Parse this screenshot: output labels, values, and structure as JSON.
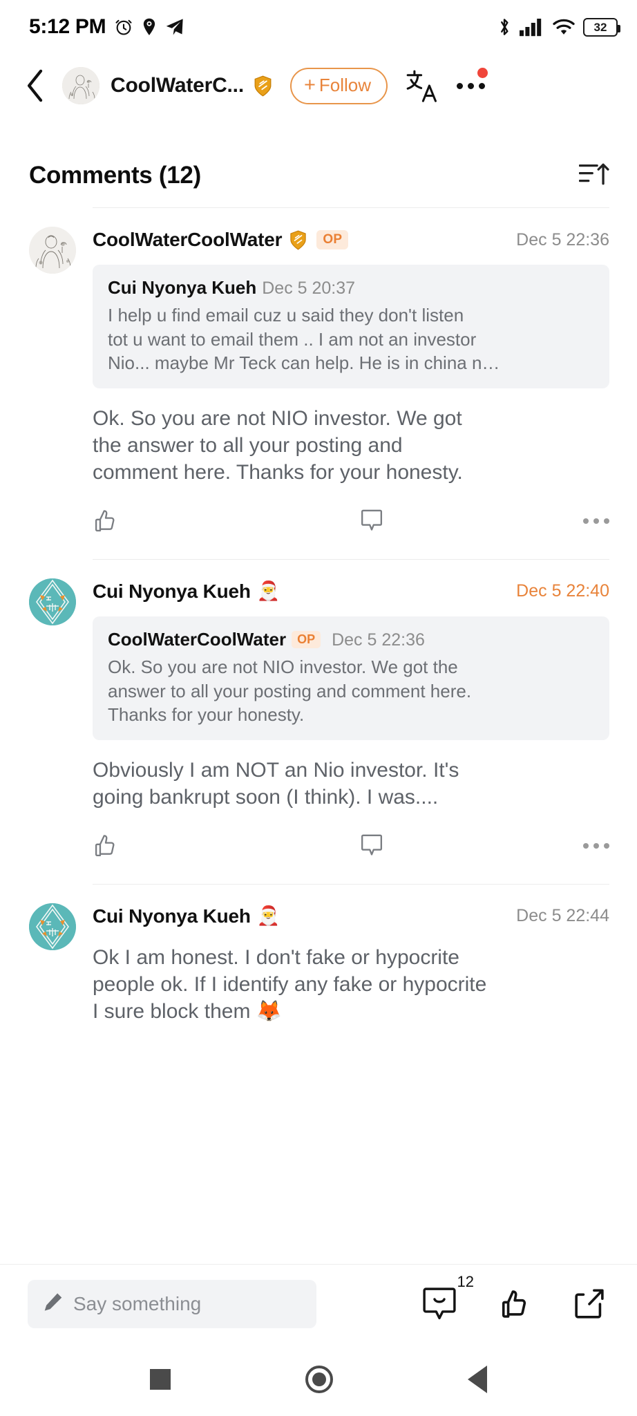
{
  "status_bar": {
    "time": "5:12 PM",
    "battery_level": "32",
    "icons": [
      "alarm-icon",
      "location-pin-icon",
      "telegram-icon",
      "bluetooth-icon",
      "cellular-signal-icon",
      "wifi-icon",
      "battery-icon"
    ]
  },
  "top_nav": {
    "back_label": "‹",
    "channel_name": "CoolWaterC...",
    "verified_badge": "shield-check-icon",
    "follow_label": "Follow",
    "follow_plus": "+",
    "translate_icon": "translate-icon",
    "more_icon": "more-horizontal-icon",
    "colors": {
      "accent": "#e8843b",
      "notification_dot": "#f0453a"
    }
  },
  "comments_header": {
    "title": "Comments (12)",
    "sort_icon": "sort-ascending-icon"
  },
  "comments": [
    {
      "avatar_type": "engraving",
      "author": "CoolWaterCoolWater",
      "has_shield": true,
      "is_op": true,
      "op_label": "OP",
      "emoji": "",
      "timestamp": "Dec 5 22:36",
      "timestamp_accent": false,
      "quote": {
        "author": "Cui Nyonya Kueh",
        "is_op": false,
        "op_label": "",
        "timestamp": "Dec 5 20:37",
        "body": "I help u find email cuz u said they don't listen\ntot u want to email them .. I am not an investor\nNio... maybe Mr Teck can help. He is in china n…"
      },
      "message": "Ok. So you  are not NIO investor.  We got\nthe answer to all your posting and\ncomment here. Thanks for your honesty.",
      "actions": {
        "like": "thumbs-up-icon",
        "reply": "comment-bubble-icon",
        "more": "more-horizontal-icon"
      }
    },
    {
      "avatar_type": "teal",
      "author": "Cui Nyonya Kueh",
      "has_shield": false,
      "is_op": false,
      "op_label": "",
      "emoji": "🎅",
      "timestamp": "Dec 5 22:40",
      "timestamp_accent": true,
      "quote": {
        "author": "CoolWaterCoolWater",
        "is_op": true,
        "op_label": "OP",
        "timestamp": "Dec 5 22:36",
        "body": "Ok. So you  are not NIO investor.  We got the\nanswer to all your posting and comment here.\nThanks for your honesty."
      },
      "message": "Obviously I am NOT an Nio investor. It's\ngoing bankrupt soon (I think). I was....",
      "actions": {
        "like": "thumbs-up-icon",
        "reply": "comment-bubble-icon",
        "more": "more-horizontal-icon"
      }
    },
    {
      "avatar_type": "teal",
      "author": "Cui Nyonya Kueh",
      "has_shield": false,
      "is_op": false,
      "op_label": "",
      "emoji": "🎅",
      "timestamp": "Dec 5 22:44",
      "timestamp_accent": false,
      "quote": null,
      "message": "Ok I am honest. I don't fake or hypocrite\npeople ok. If I identify any fake or hypocrite\nI sure block them 🦊",
      "actions": null
    }
  ],
  "bottom_bar": {
    "input_placeholder": "Say something",
    "pencil_icon": "pencil-icon",
    "comment_icon": "comment-bubble-icon",
    "comment_count": "12",
    "like_icon": "thumbs-up-icon",
    "share_icon": "share-icon"
  },
  "nav_bar": {
    "recents": "square-icon",
    "home": "circle-icon",
    "back": "triangle-back-icon"
  }
}
